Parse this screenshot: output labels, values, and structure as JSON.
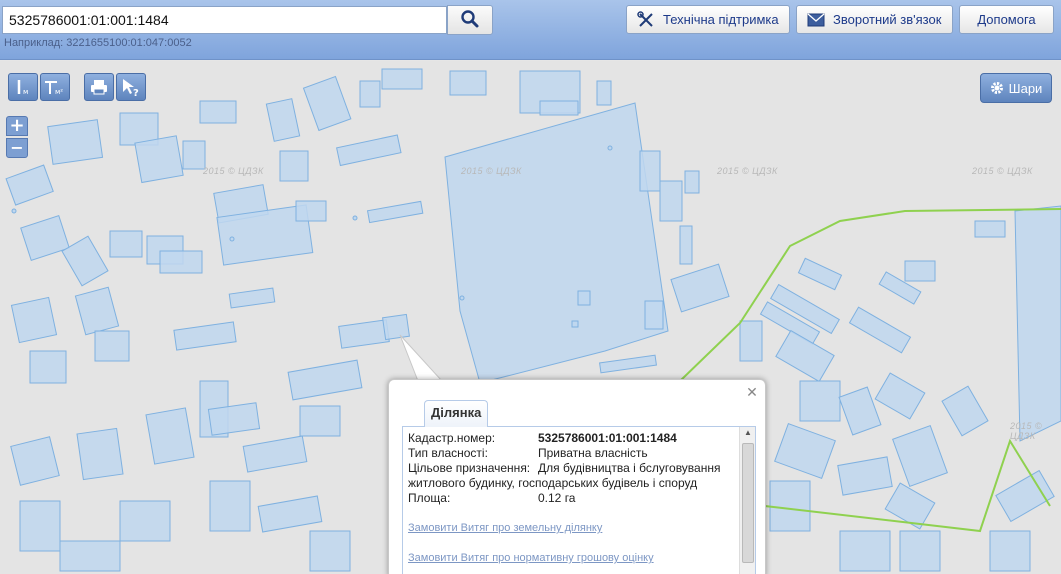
{
  "search": {
    "value": "5325786001:01:001:1484",
    "hint": "Наприклад: 3221655100:01:047:0052"
  },
  "header_buttons": {
    "support": "Технічна підтримка",
    "feedback": "Зворотний зв'язок",
    "help": "Допомога"
  },
  "map": {
    "layers_label": "Шари",
    "zoom_in": "+",
    "zoom_out": "−",
    "watermark": "2015 © ЦДЗК"
  },
  "popup": {
    "tab": "Ділянка",
    "fields": [
      {
        "label": "Кадастр.номер:",
        "value": "5325786001:01:001:1484"
      },
      {
        "label": "Тип власності:",
        "value": "Приватна власність"
      },
      {
        "label": "Цільове призначення:",
        "value": "Для будівництва і бслуговування житлового будинку, господарських будівель і споруд"
      },
      {
        "label": "Площа:",
        "value": "0.12 га"
      }
    ],
    "links": [
      "Замовити Витяг про земельну ділянку",
      "Замовити Витяг про нормативну грошову оцінку"
    ]
  },
  "colors": {
    "parcel_fill": "#bfd7ef",
    "parcel_stroke": "#7fb1e0",
    "border_line": "#8fd14f",
    "header": "#8fb0e2"
  }
}
